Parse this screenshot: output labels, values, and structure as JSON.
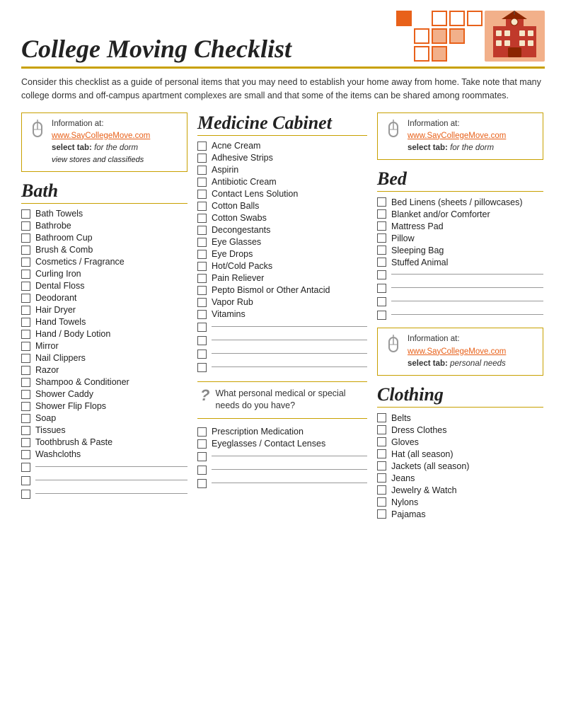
{
  "header": {
    "title": "College Moving Checklist",
    "intro": "Consider this checklist as a guide of personal items that you may need to establish your home away from home.  Take note that many college dorms and off-campus apartment complexes are small and that some of the items can be shared among roommates."
  },
  "info_box_left": {
    "label": "Information at:",
    "link": "www.SayCollegeMove.com",
    "select_label": "select tab:",
    "select_value": "for the dorm",
    "sub_text": "view stores and classifieds"
  },
  "info_box_right_top": {
    "label": "Information at:",
    "link": "www.SayCollegeMove.com",
    "select_label": "select tab:",
    "select_value": "for the dorm"
  },
  "info_box_right_bottom": {
    "label": "Information at:",
    "link": "www.SayCollegeMove.com",
    "select_label": "select tab:",
    "select_value": "personal needs"
  },
  "bath": {
    "title": "Bath",
    "items": [
      "Bath Towels",
      "Bathrobe",
      "Bathroom Cup",
      "Brush & Comb",
      "Cosmetics / Fragrance",
      "Curling Iron",
      "Dental Floss",
      "Deodorant",
      "Hair Dryer",
      "Hand Towels",
      "Hand / Body Lotion",
      "Mirror",
      "Nail Clippers",
      "Razor",
      "Shampoo & Conditioner",
      "Shower Caddy",
      "Shower Flip Flops",
      "Soap",
      "Tissues",
      "Toothbrush & Paste",
      "Washcloths"
    ],
    "blanks": 3
  },
  "medicine": {
    "title": "Medicine Cabinet",
    "items": [
      "Acne Cream",
      "Adhesive Strips",
      "Aspirin",
      "Antibiotic Cream",
      "Contact Lens Solution",
      "Cotton Balls",
      "Cotton Swabs",
      "Decongestants",
      "Eye Glasses",
      "Eye Drops",
      "Hot/Cold Packs",
      "Pain Reliever",
      "Pepto Bismol or Other Antacid",
      "Vapor Rub",
      "Vitamins"
    ],
    "blanks": 4,
    "question": "What personal medical or special needs do you have?",
    "after_items": [
      "Prescription Medication",
      "Eyeglasses / Contact Lenses"
    ],
    "after_blanks": 3
  },
  "bed": {
    "title": "Bed",
    "items": [
      "Bed Linens (sheets / pillowcases)",
      "Blanket and/or Comforter",
      "Mattress Pad",
      "Pillow",
      "Sleeping Bag",
      "Stuffed Animal"
    ],
    "blanks": 4
  },
  "clothing": {
    "title": "Clothing",
    "items": [
      "Belts",
      "Dress Clothes",
      "Gloves",
      "Hat (all season)",
      "Jackets (all season)",
      "Jeans",
      "Jewelry & Watch",
      "Nylons",
      "Pajamas"
    ]
  }
}
